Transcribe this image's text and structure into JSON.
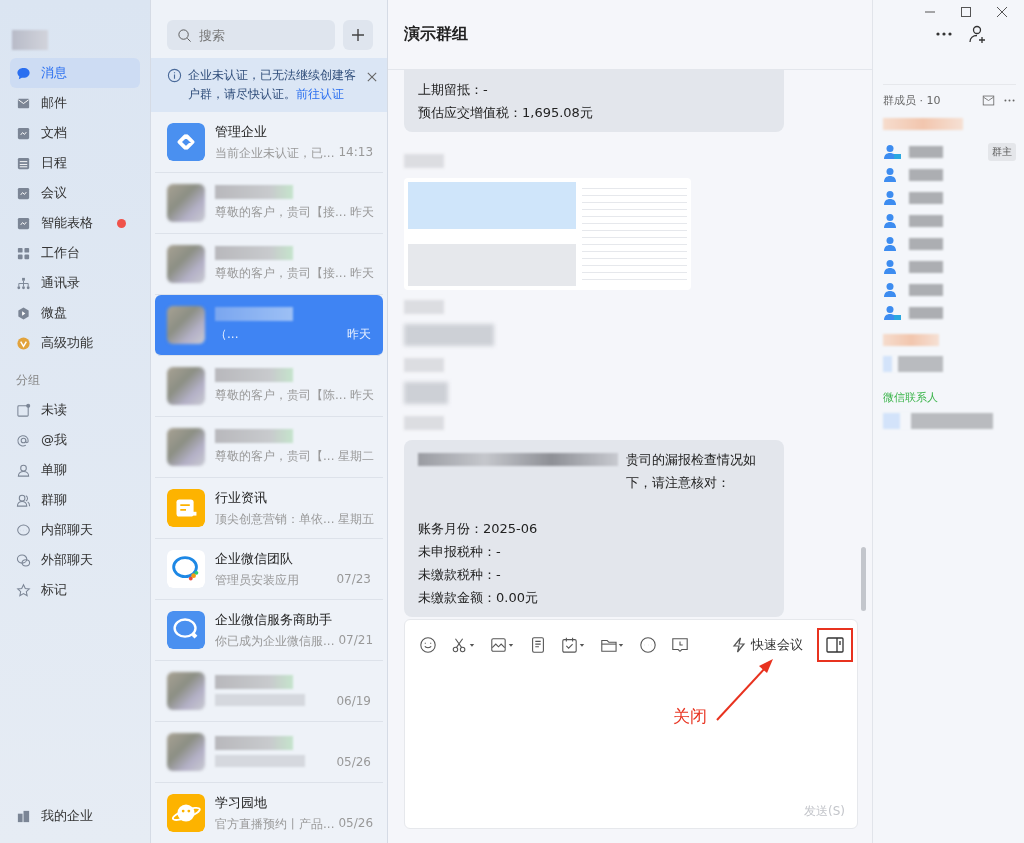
{
  "sidebar": {
    "nav_items": [
      {
        "label": "消息",
        "selected": true,
        "badge": false
      },
      {
        "label": "邮件",
        "selected": false,
        "badge": false
      },
      {
        "label": "文档",
        "selected": false,
        "badge": false
      },
      {
        "label": "日程",
        "selected": false,
        "badge": false
      },
      {
        "label": "会议",
        "selected": false,
        "badge": false
      },
      {
        "label": "智能表格",
        "selected": false,
        "badge": true
      },
      {
        "label": "工作台",
        "selected": false,
        "badge": false
      },
      {
        "label": "通讯录",
        "selected": false,
        "badge": false
      },
      {
        "label": "微盘",
        "selected": false,
        "badge": false
      },
      {
        "label": "高级功能",
        "selected": false,
        "badge": false
      }
    ],
    "group_heading": "分组",
    "group_items": [
      "未读",
      "@我",
      "单聊",
      "群聊",
      "内部聊天",
      "外部聊天",
      "标记"
    ],
    "footer": "我的企业"
  },
  "chat_list": {
    "search": {
      "placeholder": "搜索"
    },
    "notice": {
      "text": "企业未认证，已无法继续创建客户群，请尽快认证。",
      "link": "前往认证"
    },
    "chats": [
      {
        "kind": "sync",
        "name": "管理企业",
        "preview": "当前企业未认证，已...",
        "time": "14:13",
        "selected": false
      },
      {
        "kind": "blurred",
        "preview": "尊敬的客户，贵司【接...",
        "time": "昨天",
        "selected": false
      },
      {
        "kind": "blurred",
        "preview": "尊敬的客户，贵司【接...",
        "time": "昨天",
        "selected": false
      },
      {
        "kind": "blurred",
        "preview": "（...",
        "time": "昨天",
        "selected": true
      },
      {
        "kind": "blurred",
        "preview": "尊敬的客户，贵司【陈...",
        "time": "昨天",
        "selected": false
      },
      {
        "kind": "blurred",
        "preview": "尊敬的客户，贵司【...",
        "time": "星期二",
        "selected": false
      },
      {
        "kind": "news",
        "name": "行业资讯",
        "preview": "顶尖创意营销：单依...",
        "time": "星期五",
        "selected": false
      },
      {
        "kind": "wecom",
        "name": "企业微信团队",
        "preview": "管理员安装应用",
        "time": "07/23",
        "selected": false
      },
      {
        "kind": "helper",
        "name": "企业微信服务商助手",
        "preview": "你已成为企业微信服...",
        "time": "07/21",
        "selected": false
      },
      {
        "kind": "blurred",
        "time": "06/19",
        "selected": false
      },
      {
        "kind": "blurred",
        "time": "05/26",
        "selected": false
      },
      {
        "kind": "planet",
        "name": "学习园地",
        "preview": "官方直播预约丨产品...",
        "time": "05/26",
        "selected": false
      }
    ]
  },
  "chat": {
    "title": "演示群组",
    "messages": [
      {
        "kind": "text",
        "lines": [
          "上期留抵：-",
          "预估应交增值税：1,695.08元"
        ]
      },
      {
        "kind": "image"
      },
      {
        "kind": "blurred"
      },
      {
        "kind": "report",
        "intro": "贵司的漏报检查情况如下，请注意核对：",
        "lines": [
          "账务月份：2025-06",
          "未申报税种：-",
          "未缴款税种：-",
          "未缴款金额：0.00元"
        ]
      }
    ],
    "toolbar": {
      "meeting_label": "快速会议",
      "send": "发送(S)"
    },
    "annotation": "关闭"
  },
  "members": {
    "title": "群成员 · 10",
    "owner_badge": "群主",
    "list": [
      {
        "kind": "external"
      },
      {
        "kind": "internal"
      },
      {
        "kind": "internal"
      },
      {
        "kind": "internal"
      },
      {
        "kind": "internal"
      },
      {
        "kind": "internal"
      },
      {
        "kind": "internal"
      },
      {
        "kind": "external"
      }
    ],
    "wechat_heading": "微信联系人"
  }
}
